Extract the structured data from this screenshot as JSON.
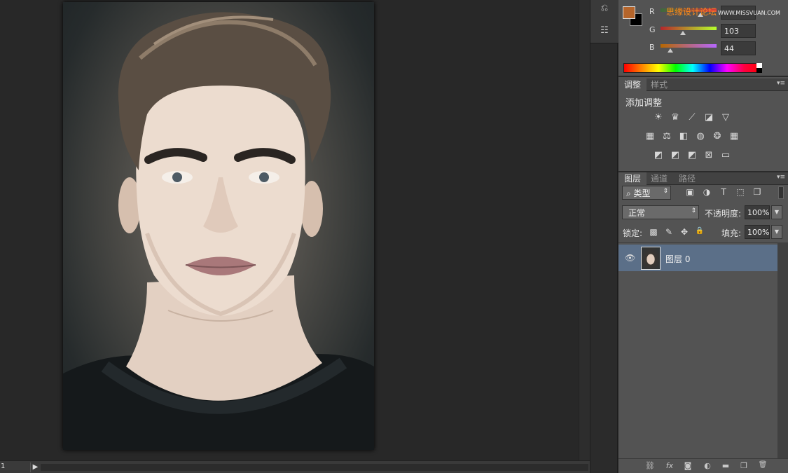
{
  "canvas": {
    "zoom_value": "1",
    "status_arrow": "▶"
  },
  "colors": {
    "foreground": "#b5652b",
    "background": "#000000",
    "highlight": "#5b6f88",
    "watermark": "#ff8c1a"
  },
  "color_panel": {
    "watermark_text": "思缘设计论坛",
    "watermark_url": "WWW.MISSVUAN.COM",
    "channels": [
      {
        "label": "R",
        "value": "",
        "level": 181
      },
      {
        "label": "G",
        "value": "103",
        "level": 103
      },
      {
        "label": "B",
        "value": "44",
        "level": 44
      }
    ]
  },
  "adjustments_panel": {
    "tabs": [
      {
        "label": "调整"
      },
      {
        "label": "样式"
      }
    ],
    "title": "添加调整",
    "menu_glyph": "▾≡",
    "icons_row1": [
      {
        "name": "brightness-icon",
        "glyph": "☀"
      },
      {
        "name": "levels-icon",
        "glyph": "♛"
      },
      {
        "name": "curves-icon",
        "glyph": "⟋"
      },
      {
        "name": "exposure-icon",
        "glyph": "◪"
      },
      {
        "name": "vibrance-icon",
        "glyph": "▽"
      }
    ],
    "icons_row2": [
      {
        "name": "hue-saturation-icon",
        "glyph": "▦"
      },
      {
        "name": "color-balance-icon",
        "glyph": "⚖"
      },
      {
        "name": "black-white-icon",
        "glyph": "◧"
      },
      {
        "name": "photo-filter-icon",
        "glyph": "◍"
      },
      {
        "name": "channel-mixer-icon",
        "glyph": "❂"
      },
      {
        "name": "color-lookup-icon",
        "glyph": "▦"
      }
    ],
    "icons_row3": [
      {
        "name": "invert-icon",
        "glyph": "◩"
      },
      {
        "name": "posterize-icon",
        "glyph": "◩"
      },
      {
        "name": "threshold-icon",
        "glyph": "◩"
      },
      {
        "name": "selective-color-icon",
        "glyph": "⊠"
      },
      {
        "name": "gradient-map-icon",
        "glyph": "▭"
      }
    ]
  },
  "layers_panel": {
    "tabs": [
      {
        "label": "图层"
      },
      {
        "label": "通道"
      },
      {
        "label": "路径"
      }
    ],
    "menu_glyph": "▾≡",
    "filter_label": "⌕ 类型",
    "filter_arrow": "⇕",
    "filter_icons": [
      {
        "name": "pixel-filter-icon",
        "glyph": "▣"
      },
      {
        "name": "adjustment-filter-icon",
        "glyph": "◑"
      },
      {
        "name": "type-filter-icon",
        "glyph": "T"
      },
      {
        "name": "shape-filter-icon",
        "glyph": "⬚"
      },
      {
        "name": "smart-object-filter-icon",
        "glyph": "❐"
      }
    ],
    "blend_mode": "正常",
    "blend_arrow": "⇕",
    "opacity_label": "不透明度:",
    "opacity_value": "100%",
    "lock_label": "锁定:",
    "lock_icons": [
      {
        "name": "lock-transparent-icon",
        "glyph": "▩"
      },
      {
        "name": "lock-image-icon",
        "glyph": "✎"
      },
      {
        "name": "lock-position-icon",
        "glyph": "✥"
      },
      {
        "name": "lock-all-icon",
        "glyph": "🔒"
      }
    ],
    "fill_label": "填充:",
    "fill_value": "100%",
    "dropdown_glyph": "▼",
    "layers": [
      {
        "name": "图层 0",
        "eye": "👁"
      }
    ],
    "footer_icons": [
      {
        "name": "link-layers-icon",
        "glyph": "⛓"
      },
      {
        "name": "fx-icon",
        "glyph": "fx"
      },
      {
        "name": "add-mask-icon",
        "glyph": "◙"
      },
      {
        "name": "new-adjustment-icon",
        "glyph": "◐"
      },
      {
        "name": "new-group-icon",
        "glyph": "▬"
      },
      {
        "name": "new-layer-icon",
        "glyph": "❐"
      },
      {
        "name": "delete-layer-icon",
        "glyph": "🗑"
      }
    ]
  },
  "toolstrip": {
    "buttons": [
      {
        "name": "history-icon",
        "glyph": "⎌"
      },
      {
        "name": "properties-icon",
        "glyph": "☷"
      }
    ]
  }
}
